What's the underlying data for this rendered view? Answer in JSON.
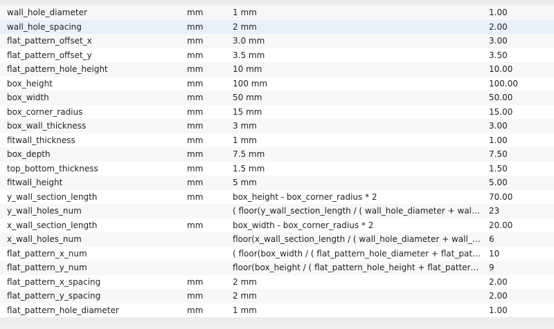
{
  "parameters": [
    {
      "name": "wall_hole_diameter",
      "unit": "mm",
      "expression": "1 mm",
      "value": "1.00"
    },
    {
      "name": "wall_hole_spacing",
      "unit": "mm",
      "expression": "2 mm",
      "value": "2.00"
    },
    {
      "name": "flat_pattern_offset_x",
      "unit": "mm",
      "expression": "3.0 mm",
      "value": "3.00"
    },
    {
      "name": "flat_pattern_offset_y",
      "unit": "mm",
      "expression": "3.5 mm",
      "value": "3.50"
    },
    {
      "name": "flat_pattern_hole_height",
      "unit": "mm",
      "expression": "10 mm",
      "value": "10.00"
    },
    {
      "name": "box_height",
      "unit": "mm",
      "expression": "100 mm",
      "value": "100.00"
    },
    {
      "name": "box_width",
      "unit": "mm",
      "expression": "50 mm",
      "value": "50.00"
    },
    {
      "name": "box_corner_radius",
      "unit": "mm",
      "expression": "15 mm",
      "value": "15.00"
    },
    {
      "name": "box_wall_thickness",
      "unit": "mm",
      "expression": "3 mm",
      "value": "3.00"
    },
    {
      "name": "fitwall_thickness",
      "unit": "mm",
      "expression": "1 mm",
      "value": "1.00"
    },
    {
      "name": "box_depth",
      "unit": "mm",
      "expression": "7.5 mm",
      "value": "7.50"
    },
    {
      "name": "top_bottom_thickness",
      "unit": "mm",
      "expression": "1.5 mm",
      "value": "1.50"
    },
    {
      "name": "fitwall_height",
      "unit": "mm",
      "expression": "5 mm",
      "value": "5.00"
    },
    {
      "name": "y_wall_section_length",
      "unit": "mm",
      "expression": "box_height - box_corner_radius * 2",
      "value": "70.00"
    },
    {
      "name": "y_wall_holes_num",
      "unit": "",
      "expression": "( floor(y_wall_section_length / ( wall_hole_diameter + wall_ho...",
      "value": "23"
    },
    {
      "name": "x_wall_section_length",
      "unit": "mm",
      "expression": "box_width - box_corner_radius * 2",
      "value": "20.00"
    },
    {
      "name": "x_wall_holes_num",
      "unit": "",
      "expression": "floor(x_wall_section_length / ( wall_hole_diameter + wall_hol...",
      "value": "6"
    },
    {
      "name": "flat_pattern_x_num",
      "unit": "",
      "expression": "( floor(box_width / ( flat_pattern_hole_diameter + flat_pattern...",
      "value": "10"
    },
    {
      "name": "flat_pattern_y_num",
      "unit": "",
      "expression": "floor(box_height / ( flat_pattern_hole_height + flat_pattern_h...",
      "value": "9"
    },
    {
      "name": "flat_pattern_x_spacing",
      "unit": "mm",
      "expression": "2 mm",
      "value": "2.00"
    },
    {
      "name": "flat_pattern_y_spacing",
      "unit": "mm",
      "expression": "2 mm",
      "value": "2.00"
    },
    {
      "name": "flat_pattern_hole_diameter",
      "unit": "mm",
      "expression": "1 mm",
      "value": "1.00"
    }
  ],
  "selected_row": 1,
  "colors": {
    "selected_row": "#e7f1fb",
    "row_alt": "#f7f7f7",
    "row": "#ffffff"
  }
}
